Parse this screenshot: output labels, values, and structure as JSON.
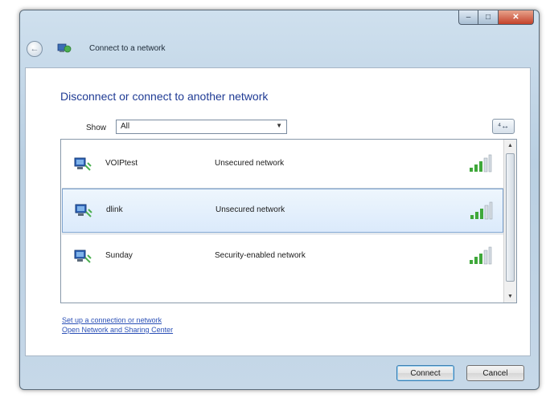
{
  "window": {
    "title": "Connect to a network",
    "icon": "network-globe-icon",
    "controls": {
      "minimize": "–",
      "maximize": "□",
      "close": "✕"
    },
    "back_glyph": "←"
  },
  "content": {
    "heading": "Disconnect or connect to another network",
    "show_label": "Show",
    "show_value": "All",
    "select_arrow": "▼",
    "refresh_glyph": "⁴↔"
  },
  "networks": [
    {
      "name": "VOIPtest",
      "security": "Unsecured network",
      "icon": "wireless-network-icon",
      "signal": "signal-bars-icon"
    },
    {
      "name": "dlink",
      "security": "Unsecured network",
      "icon": "wireless-network-icon",
      "signal": "signal-bars-icon"
    },
    {
      "name": "Sunday",
      "security": "Security-enabled network",
      "icon": "wireless-network-icon",
      "signal": "signal-bars-icon"
    }
  ],
  "scrollbar": {
    "up": "▲",
    "down": "▼"
  },
  "links": {
    "setup": "Set up a connection or network",
    "sharing": "Open Network and Sharing Center"
  },
  "buttons": {
    "connect": "Connect",
    "cancel": "Cancel"
  },
  "colors": {
    "heading": "#1f3b94",
    "link": "#2a4fb6",
    "selection": "#dbeafb",
    "signal": "#3fa83a"
  }
}
